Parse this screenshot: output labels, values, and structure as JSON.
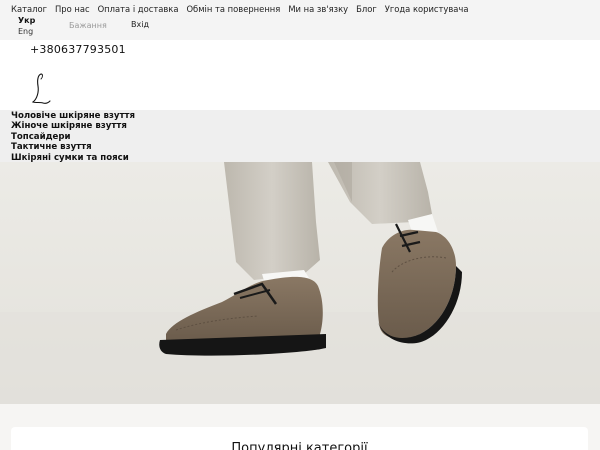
{
  "nav": {
    "links": [
      "Каталог",
      "Про нас",
      "Оплата і доставка",
      "Обмін та повернення",
      "Ми на зв'язку",
      "Блог",
      "Угода користувача"
    ],
    "language_active": "Укр",
    "language_alt": "Eng",
    "wishlist": "Бажання",
    "login": "Вхід"
  },
  "header": {
    "phone": "+380637793501",
    "logo_icon": "script-l-logo-icon"
  },
  "categories": [
    "Чоловіче шкіряне взуття",
    "Жіноче шкіряне взуття",
    "Топсайдери",
    "Тактичне взуття",
    "Шкіряні сумки та пояси"
  ],
  "hero": {
    "image": "man-in-brown-leather-brogues-photo"
  },
  "popular": {
    "title": "Популярні категорії"
  },
  "colors": {
    "nav_bg": "#f4f4f4",
    "cats_bg": "#efefef",
    "shoe": "#7a6a58",
    "sole": "#1a1a1a",
    "trousers": "#c9c5bd"
  }
}
